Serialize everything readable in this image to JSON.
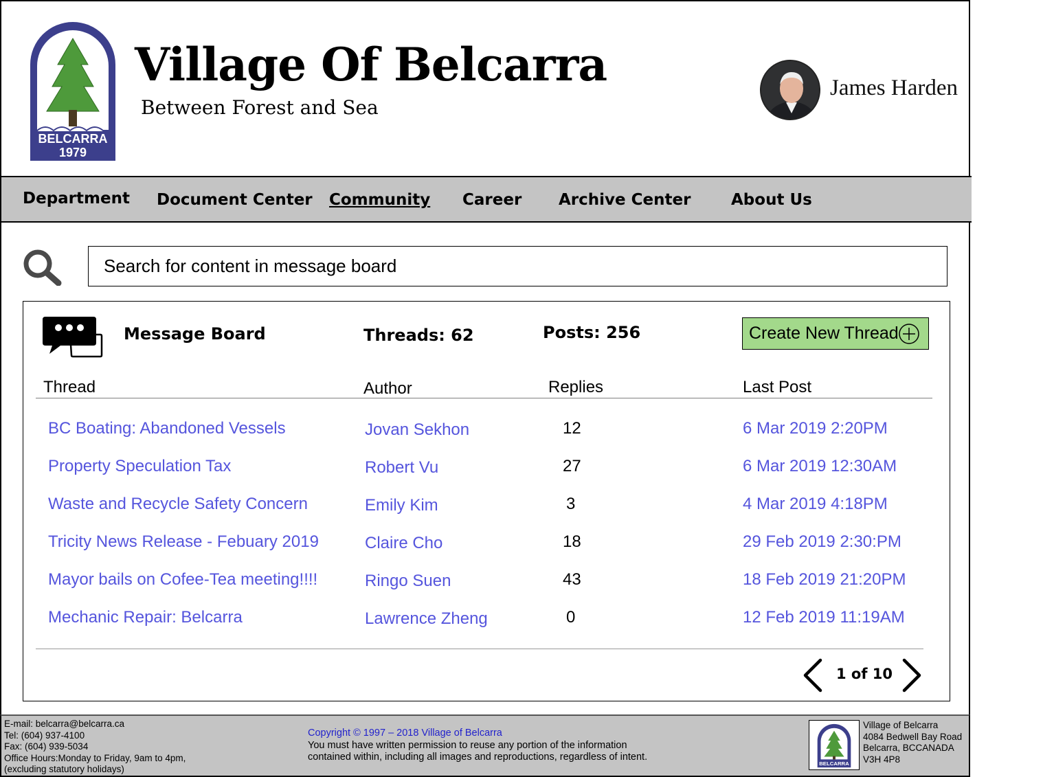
{
  "header": {
    "title": "Village Of Belcarra",
    "tagline": "Between Forest and Sea",
    "logo_text": "BELCARRA",
    "logo_year": "1979",
    "user_name": "James Harden"
  },
  "nav": {
    "items": [
      {
        "label": "Department"
      },
      {
        "label": "Document Center"
      },
      {
        "label": "Community",
        "active": true
      },
      {
        "label": "Career"
      },
      {
        "label": "Archive Center"
      },
      {
        "label": "About Us"
      }
    ]
  },
  "search": {
    "placeholder": "Search for content in message board",
    "icon": "search-icon"
  },
  "board": {
    "title": "Message Board",
    "threads_stat": "Threads: 62",
    "posts_stat": "Posts: 256",
    "create_label": "Create New Thread",
    "columns": {
      "thread": "Thread",
      "author": "Author",
      "replies": "Replies",
      "last_post": "Last Post"
    },
    "rows": [
      {
        "thread": "BC Boating: Abandoned Vessels",
        "author": "Jovan Sekhon",
        "replies": "12",
        "last_post": "6 Mar 2019 2:20PM"
      },
      {
        "thread": "Property Speculation Tax",
        "author": "Robert Vu",
        "replies": "27",
        "last_post": "6 Mar 2019 12:30AM"
      },
      {
        "thread": "Waste and Recycle Safety Concern",
        "author": "Emily Kim",
        "replies": "3",
        "last_post": "4 Mar 2019 4:18PM"
      },
      {
        "thread": "Tricity News Release - Febuary 2019",
        "author": "Claire Cho",
        "replies": "18",
        "last_post": "29 Feb 2019 2:30:PM"
      },
      {
        "thread": "Mayor bails on Cofee-Tea meeting!!!!",
        "author": "Ringo Suen",
        "replies": "43",
        "last_post": "18 Feb 2019 21:20PM"
      },
      {
        "thread": "Mechanic Repair: Belcarra",
        "author": "Lawrence Zheng",
        "replies": "0",
        "last_post": "12 Feb 2019 11:19AM"
      }
    ],
    "pagination": {
      "label": "1 of 10"
    }
  },
  "footer": {
    "contact": [
      "E-mail: belcarra@belcarra.ca",
      "Tel: (604) 937-4100",
      "Fax: (604) 939-5034",
      "Office Hours:Monday to Friday, 9am to 4pm,",
      "(excluding statutory holidays)"
    ],
    "copyright": "Copyright © 1997 – 2018 Village of Belcarra",
    "notice": [
      "You must have written permission to reuse any portion of the information",
      "contained within, including all images and reproductions, regardless of intent."
    ],
    "logo_text": "BELCARRA",
    "address": [
      "Village of Belcarra",
      "4084 Bedwell Bay Road",
      "Belcarra, BCCANADA",
      "V3H 4P8"
    ]
  },
  "colors": {
    "nav_bg": "#c4c4c4",
    "link": "#5555dd",
    "create_button": "#a3d98b",
    "copyright": "#2222cc",
    "logo_blue": "#3c3f8c",
    "tree_green": "#4e9a3b"
  }
}
